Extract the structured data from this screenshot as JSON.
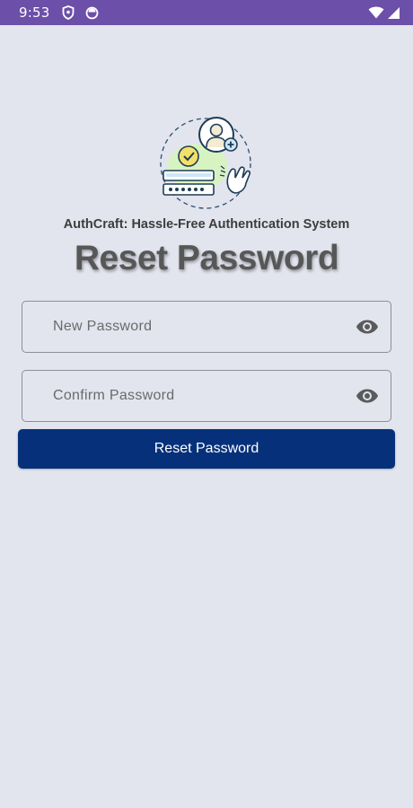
{
  "status_bar": {
    "time": "9:53",
    "icons": [
      "shield-icon",
      "record-icon",
      "wifi-icon",
      "signal-icon"
    ],
    "color": "#6b4fa8"
  },
  "header": {
    "subtitle": "AuthCraft: Hassle-Free Authentication System",
    "title": "Reset Password",
    "illustration": "authentication-illustration"
  },
  "form": {
    "new_password": {
      "value": "",
      "placeholder": "New Password",
      "icon": "eye-icon"
    },
    "confirm_password": {
      "value": "",
      "placeholder": "Confirm Password",
      "icon": "eye-icon"
    },
    "submit_label": "Reset Password"
  },
  "colors": {
    "background": "#e2e4ee",
    "button": "#06317a",
    "button_text": "#ffffff",
    "title_text": "#575757"
  }
}
